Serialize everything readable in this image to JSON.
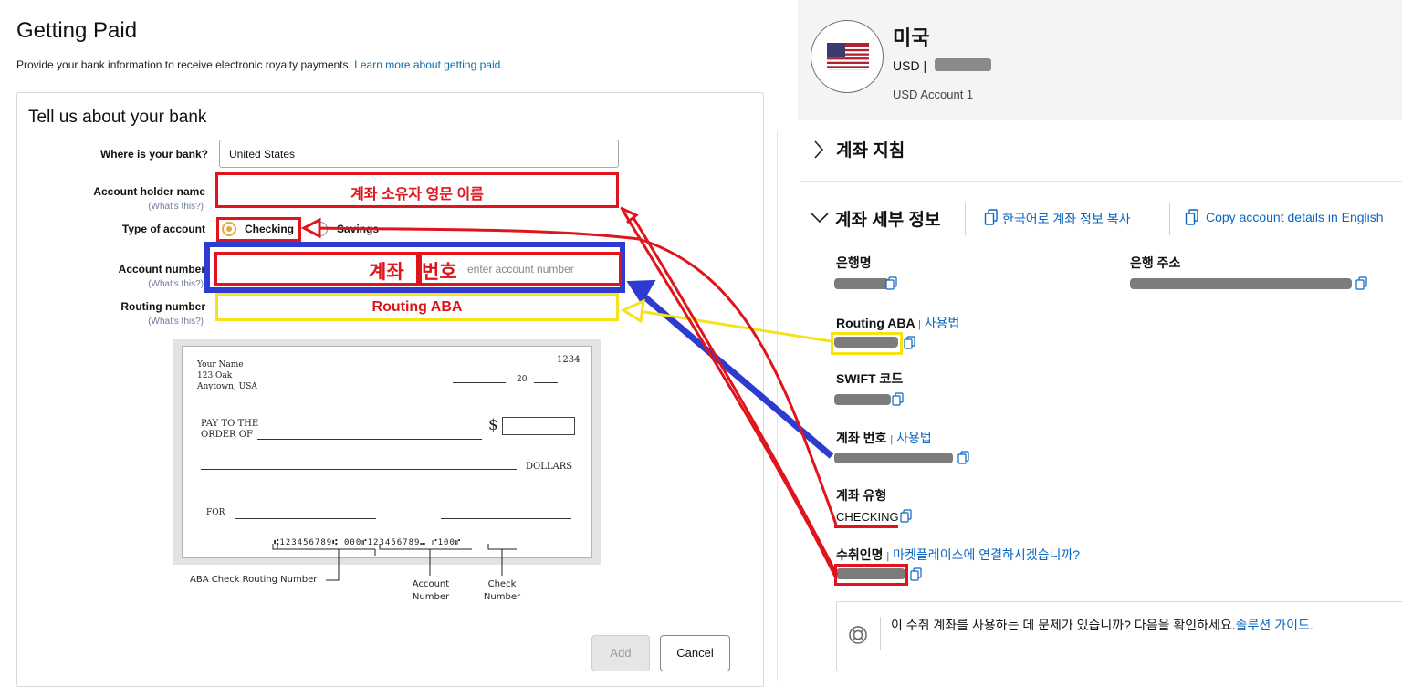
{
  "left": {
    "title": "Getting Paid",
    "subtitle": "Provide your bank information to receive electronic royalty payments.",
    "subtitle_link": "Learn more about getting paid.",
    "box_title": "Tell us about your bank",
    "fields": {
      "country_label": "Where is your bank?",
      "country_value": "United States",
      "holder_label": "Account holder name",
      "holder_hint": "(What's this?)",
      "type_label": "Type of account",
      "checking": "Checking",
      "savings": "Savings",
      "number_label": "Account number",
      "number_hint": "(What's this?)",
      "number_placeholder": "enter account number",
      "routing_label": "Routing number",
      "routing_hint": "(What's this?)"
    },
    "overlays": {
      "holder": "계좌 소유자 영문 이름",
      "number_a": "계좌",
      "number_b": "번호",
      "routing": "Routing ABA"
    },
    "cheque": {
      "name": "Your Name",
      "addr1": "123 Oak",
      "addr2": "Anytown, USA",
      "number": "1234",
      "year": "20",
      "pay_line1": "PAY TO THE",
      "pay_line2": "ORDER OF",
      "dollar_sign": "$",
      "dollars": "DOLLARS",
      "for": "FOR",
      "micr": "⑆123456789⑆  000⑈123456789⑉ ⑈100⑈",
      "cap_routing": "ABA Check Routing Number",
      "cap_account_1": "Account",
      "cap_account_2": "Number",
      "cap_check_1": "Check",
      "cap_check_2": "Number"
    },
    "buttons": {
      "add": "Add",
      "cancel": "Cancel"
    }
  },
  "right": {
    "country": "미국",
    "currency": "USD |",
    "account_name": "USD Account 1",
    "section_guide": "계좌 지침",
    "section_details": "계좌 세부 정보",
    "copy_korean": "한국어로 계좌 정보 복사",
    "copy_english": "Copy account details in English",
    "bank_name_label": "은행명",
    "bank_address_label": "은행 주소",
    "routing_label": "Routing ABA",
    "how_to": "사용법",
    "swift_label": "SWIFT 코드",
    "account_number_label": "계좌 번호",
    "account_type_label": "계좌 유형",
    "account_type_value": "CHECKING",
    "payee_label": "수취인명",
    "payee_link": "마켓플레이스에 연결하시겠습니까?",
    "notice": "이 수취 계좌를 사용하는 데 문제가 있습니까? 다음을 확인하세요.",
    "notice_link": "솔루션 가이드."
  },
  "colors": {
    "annot_red": "#e0141c",
    "annot_yellow": "#f5e21b",
    "annot_blue": "#2d3bd1",
    "link": "#0a66c2"
  },
  "icons": [
    "us-flag-icon",
    "chevron-right-icon",
    "chevron-down-icon",
    "copy-icon",
    "lifebuoy-icon"
  ]
}
